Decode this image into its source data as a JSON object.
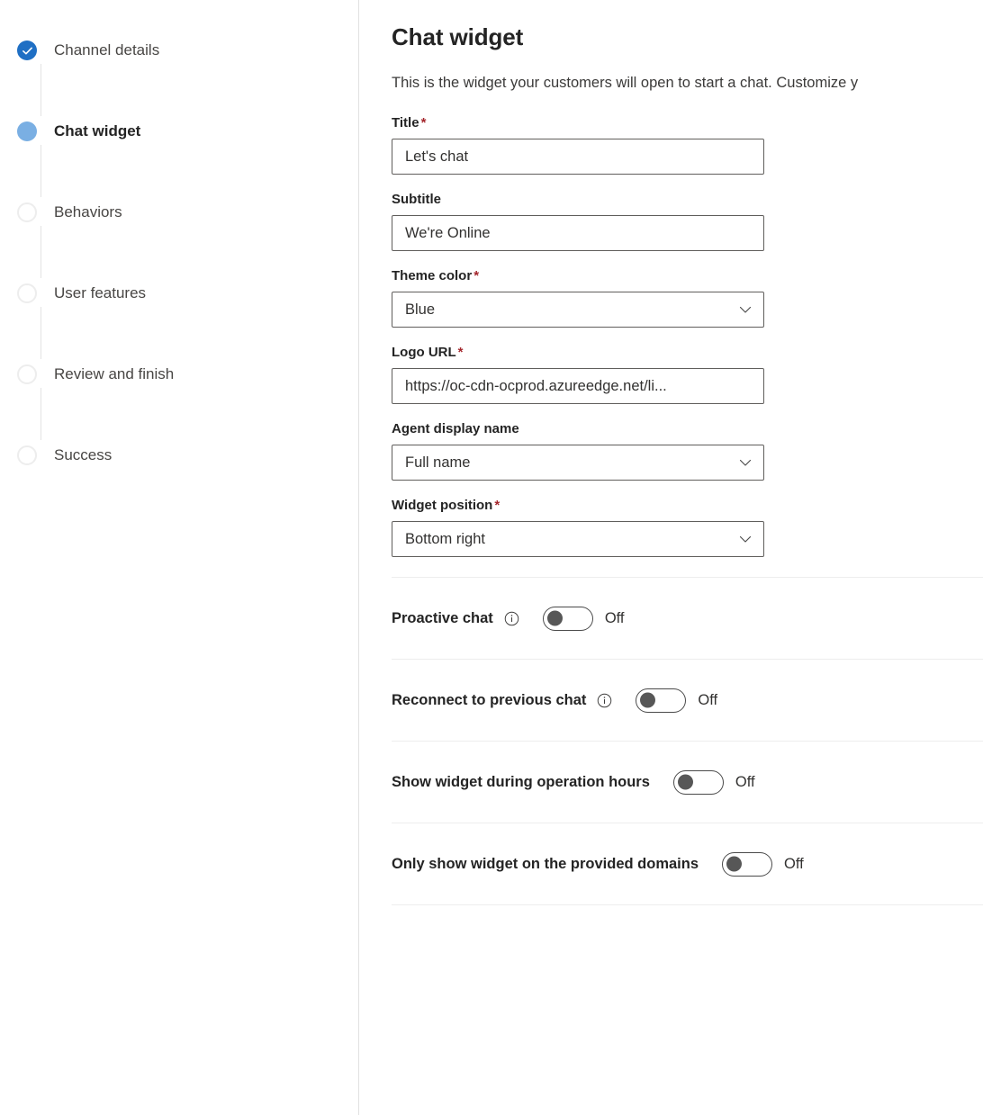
{
  "stepper": {
    "steps": [
      {
        "label": "Channel details",
        "state": "done",
        "icon": "check-icon"
      },
      {
        "label": "Chat widget",
        "state": "current",
        "icon": "filled-circle-icon"
      },
      {
        "label": "Behaviors",
        "state": "todo",
        "icon": "empty-circle-icon"
      },
      {
        "label": "User features",
        "state": "todo",
        "icon": "empty-circle-icon"
      },
      {
        "label": "Review and finish",
        "state": "todo",
        "icon": "empty-circle-icon"
      },
      {
        "label": "Success",
        "state": "todo",
        "icon": "empty-circle-icon"
      }
    ]
  },
  "main": {
    "title": "Chat widget",
    "description": "This is the widget your customers will open to start a chat. Customize y",
    "required_marker": "*",
    "fields": [
      {
        "label": "Title",
        "required": true,
        "type": "text",
        "value": "Let's chat"
      },
      {
        "label": "Subtitle",
        "required": false,
        "type": "text",
        "value": "We're Online"
      },
      {
        "label": "Theme color",
        "required": true,
        "type": "select",
        "value": "Blue"
      },
      {
        "label": "Logo URL",
        "required": true,
        "type": "text",
        "value": "https://oc-cdn-ocprod.azureedge.net/li..."
      },
      {
        "label": "Agent display name",
        "required": false,
        "type": "select",
        "value": "Full name"
      },
      {
        "label": "Widget position",
        "required": true,
        "type": "select",
        "value": "Bottom right"
      }
    ],
    "toggles": [
      {
        "label": "Proactive chat",
        "info": true,
        "state": "Off",
        "on": false
      },
      {
        "label": "Reconnect to previous chat",
        "info": true,
        "state": "Off",
        "on": false
      },
      {
        "label": "Show widget during operation hours",
        "info": false,
        "state": "Off",
        "on": false
      },
      {
        "label": "Only show widget on the provided domains",
        "info": false,
        "state": "Off",
        "on": false
      }
    ]
  },
  "colors": {
    "step_done": "#1f6fc4",
    "step_current": "#7aafe3",
    "step_todo_ring": "#ededed",
    "required_asterisk": "#a4262c",
    "divider": "#ededed",
    "control_border": "#605e5c"
  }
}
